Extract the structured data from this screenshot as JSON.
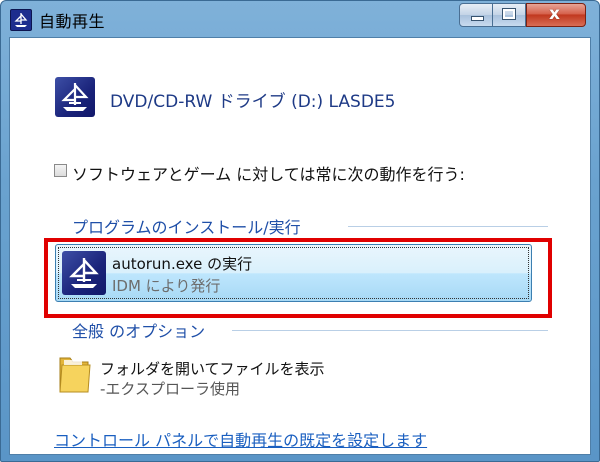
{
  "window": {
    "title": "自動再生"
  },
  "device": {
    "label": "DVD/CD-RW ドライブ (D:) LASDE5"
  },
  "always_checkbox": {
    "label": "ソフトウェアとゲーム に対しては常に次の動作を行う:",
    "checked": false
  },
  "groups": [
    {
      "header": "プログラムのインストール/実行",
      "options": [
        {
          "title": "autorun.exe の実行",
          "subtitle": "IDM により発行",
          "icon": "app-ship-icon"
        }
      ]
    },
    {
      "header": "全般 のオプション",
      "options": [
        {
          "title": "フォルダを開いてファイルを表示",
          "subtitle": "-エクスプローラ使用",
          "icon": "folder-icon"
        }
      ]
    }
  ],
  "footer": {
    "link": "コントロール パネルで自動再生の既定を設定します"
  },
  "colors": {
    "highlight": "#e00000",
    "link": "#1a5fc0",
    "title_bar": "#6aa2cf"
  }
}
